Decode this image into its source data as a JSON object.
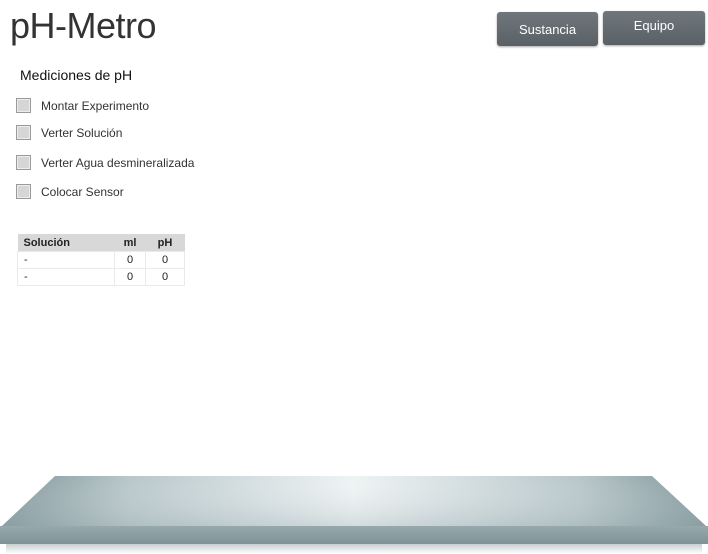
{
  "app": {
    "title": "pH-Metro"
  },
  "toolbar": {
    "sustancia_label": "Sustancia",
    "equipo_label": "Equipo"
  },
  "measurements": {
    "title": "Mediciones de pH",
    "steps": [
      {
        "label": "Montar Experimento",
        "checked": false
      },
      {
        "label": "Verter Solución",
        "checked": false
      },
      {
        "label": "Verter Agua desmineralizada",
        "checked": false
      },
      {
        "label": "Colocar Sensor",
        "checked": false
      }
    ]
  },
  "table": {
    "headers": [
      "Solución",
      "ml",
      "pH"
    ],
    "rows": [
      [
        "-",
        "0",
        "0"
      ],
      [
        "-",
        "0",
        "0"
      ]
    ]
  },
  "colors": {
    "button_bg": "#63696e",
    "bench_top": "#b4c3c6",
    "bench_edge": "#8fa0a4"
  }
}
